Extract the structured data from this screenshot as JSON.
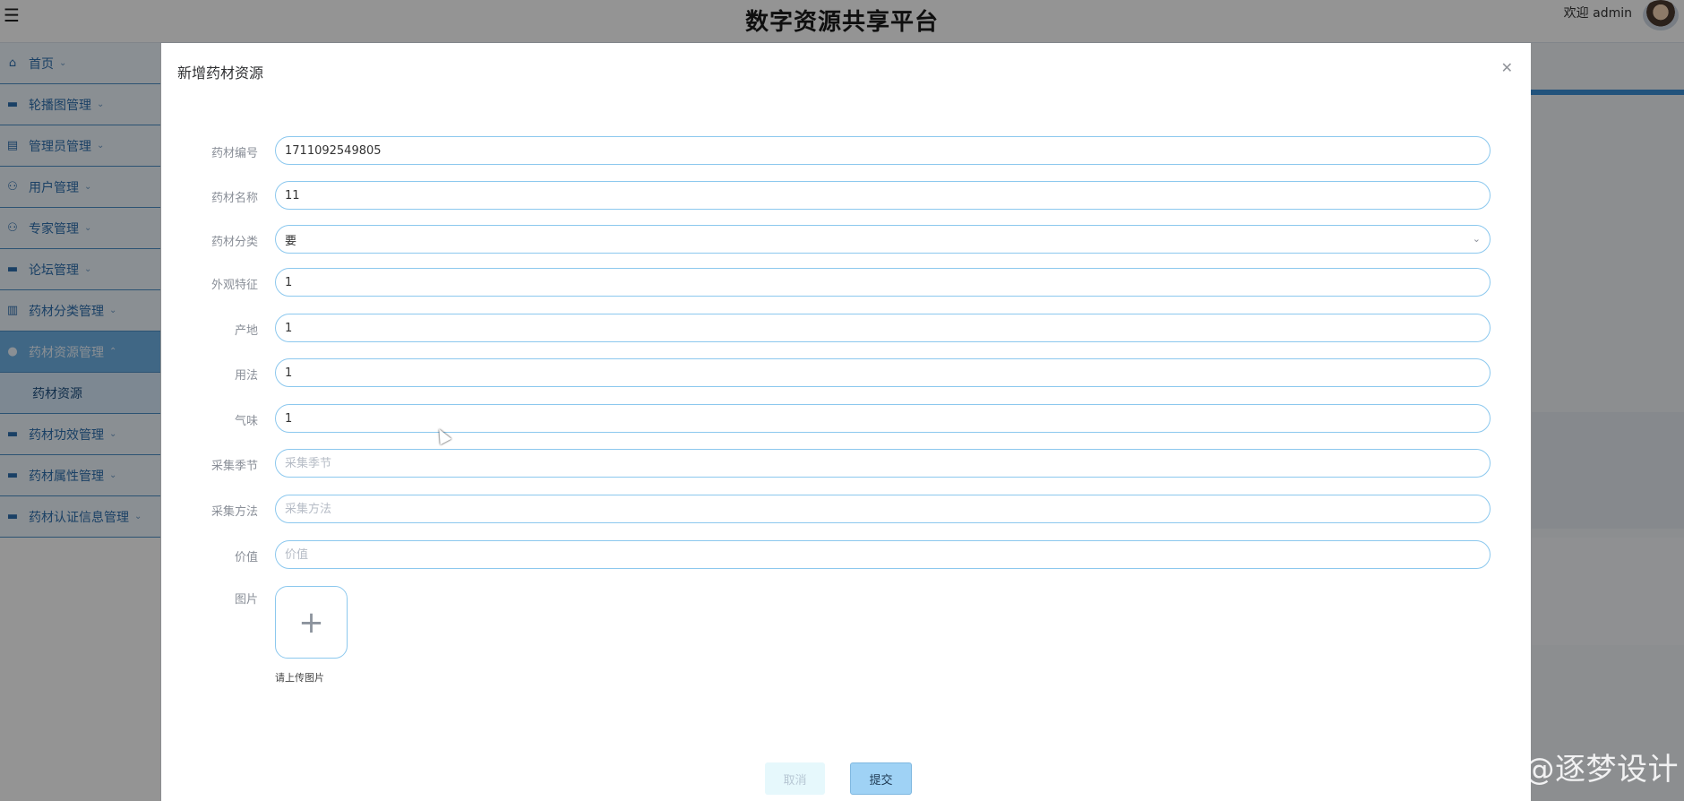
{
  "header": {
    "menu_icon": "hamburger-icon",
    "title": "数字资源共享平台",
    "welcome": "欢迎 admin"
  },
  "sidebar": {
    "items": [
      {
        "label": "首页",
        "icon": "home-icon"
      },
      {
        "label": "轮播图管理",
        "icon": "image-icon"
      },
      {
        "label": "管理员管理",
        "icon": "briefcase-icon"
      },
      {
        "label": "用户管理",
        "icon": "user-icon"
      },
      {
        "label": "专家管理",
        "icon": "user-icon"
      },
      {
        "label": "论坛管理",
        "icon": "folder-icon"
      },
      {
        "label": "药材分类管理",
        "icon": "list-icon"
      },
      {
        "label": "药材资源管理",
        "icon": "drop-icon",
        "active": true
      },
      {
        "label": "药材资源",
        "sub": true
      },
      {
        "label": "药材功效管理",
        "icon": "box-icon"
      },
      {
        "label": "药材属性管理",
        "icon": "box-icon"
      },
      {
        "label": "药材认证信息管理",
        "icon": "card-icon"
      }
    ]
  },
  "dialog": {
    "title": "新增药材资源",
    "close_icon": "close-icon",
    "fields": [
      {
        "label": "药材编号",
        "value": "1711092549805",
        "placeholder": ""
      },
      {
        "label": "药材名称",
        "value": "11",
        "placeholder": ""
      },
      {
        "label": "药材分类",
        "value": "要",
        "type": "select"
      },
      {
        "label": "外观特征",
        "value": "1",
        "placeholder": ""
      },
      {
        "label": "产地",
        "value": "1",
        "placeholder": ""
      },
      {
        "label": "用法",
        "value": "1",
        "placeholder": ""
      },
      {
        "label": "气味",
        "value": "1",
        "placeholder": ""
      },
      {
        "label": "采集季节",
        "value": "",
        "placeholder": "采集季节"
      },
      {
        "label": "采集方法",
        "value": "",
        "placeholder": "采集方法"
      },
      {
        "label": "价值",
        "value": "",
        "placeholder": "价值"
      }
    ],
    "image_label": "图片",
    "upload_hint": "请上传图片",
    "cancel_label": "取消",
    "submit_label": "提交"
  },
  "watermark": "CSDN @逐梦设计"
}
